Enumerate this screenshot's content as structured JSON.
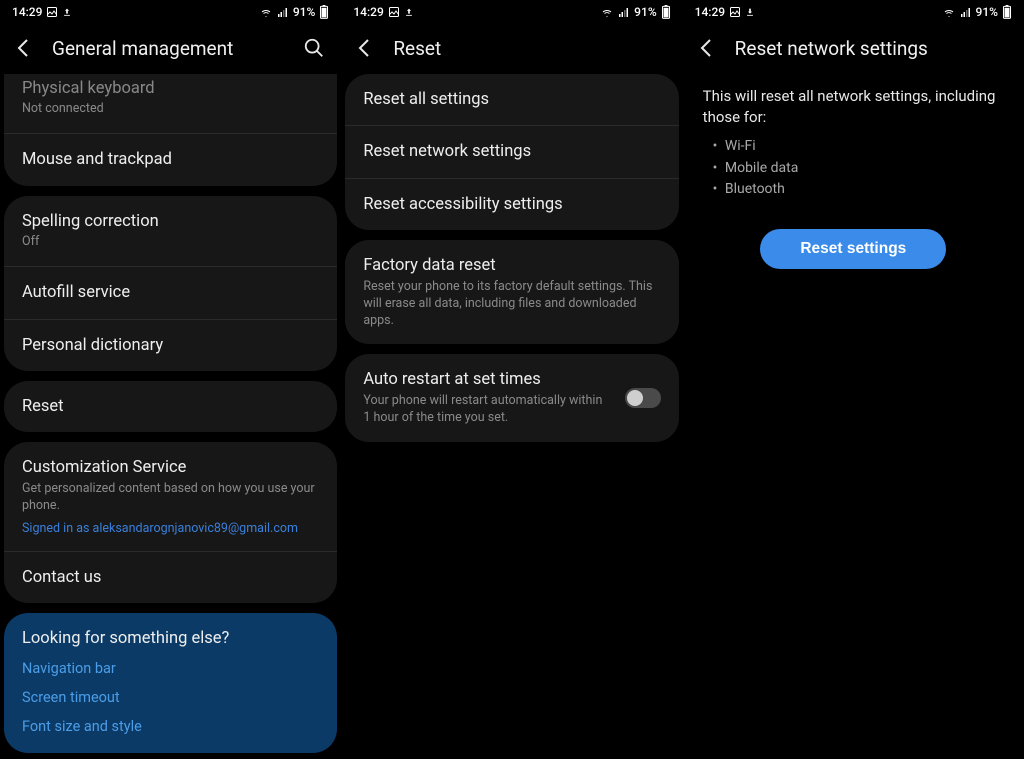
{
  "status": {
    "time": "14:29",
    "battery_pct": "91%"
  },
  "panel1": {
    "title": "General management",
    "card1": {
      "item1_title": "Physical keyboard",
      "item1_sub": "Not connected",
      "item2_title": "Mouse and trackpad"
    },
    "card2": {
      "item1_title": "Spelling correction",
      "item1_sub": "Off",
      "item2_title": "Autofill service",
      "item3_title": "Personal dictionary"
    },
    "card3": {
      "item1_title": "Reset"
    },
    "card4": {
      "item1_title": "Customization Service",
      "item1_sub": "Get personalized content based on how you use your phone.",
      "item1_link": "Signed in as aleksandarognjanovic89@gmail.com",
      "item2_title": "Contact us"
    },
    "suggest": {
      "heading": "Looking for something else?",
      "link1": "Navigation bar",
      "link2": "Screen timeout",
      "link3": "Font size and style"
    }
  },
  "panel2": {
    "title": "Reset",
    "card1": {
      "item1": "Reset all settings",
      "item2": "Reset network settings",
      "item3": "Reset accessibility settings"
    },
    "card2": {
      "item1_title": "Factory data reset",
      "item1_sub": "Reset your phone to its factory default settings. This will erase all data, including files and downloaded apps."
    },
    "card3": {
      "item1_title": "Auto restart at set times",
      "item1_sub": "Your phone will restart automatically within 1 hour of the time you set."
    }
  },
  "panel3": {
    "title": "Reset network settings",
    "desc": "This will reset all network settings, including those for:",
    "bullets": {
      "b1": "Wi-Fi",
      "b2": "Mobile data",
      "b3": "Bluetooth"
    },
    "cta": "Reset settings"
  }
}
